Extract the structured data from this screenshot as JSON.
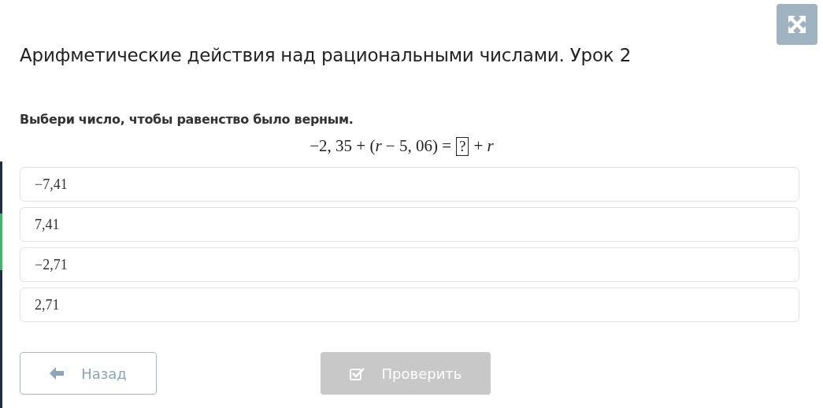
{
  "title": "Арифметические действия над рациональными числами. Урок 2",
  "question": "Выбери число, чтобы равенство было верным.",
  "equation": {
    "left": "−2, 35 + (*r* − 5, 06) =",
    "box": "?",
    "right": "+ *r*"
  },
  "options": [
    {
      "label": "−7,41",
      "selected": false
    },
    {
      "label": "7,41",
      "selected": false
    },
    {
      "label": "−2,71",
      "selected": false
    },
    {
      "label": "2,71",
      "selected": false
    }
  ],
  "buttons": [
    {
      "kind": "back",
      "label": "Назад",
      "disabled": false
    },
    {
      "kind": "check",
      "label": "Проверить",
      "disabled": true
    }
  ]
}
